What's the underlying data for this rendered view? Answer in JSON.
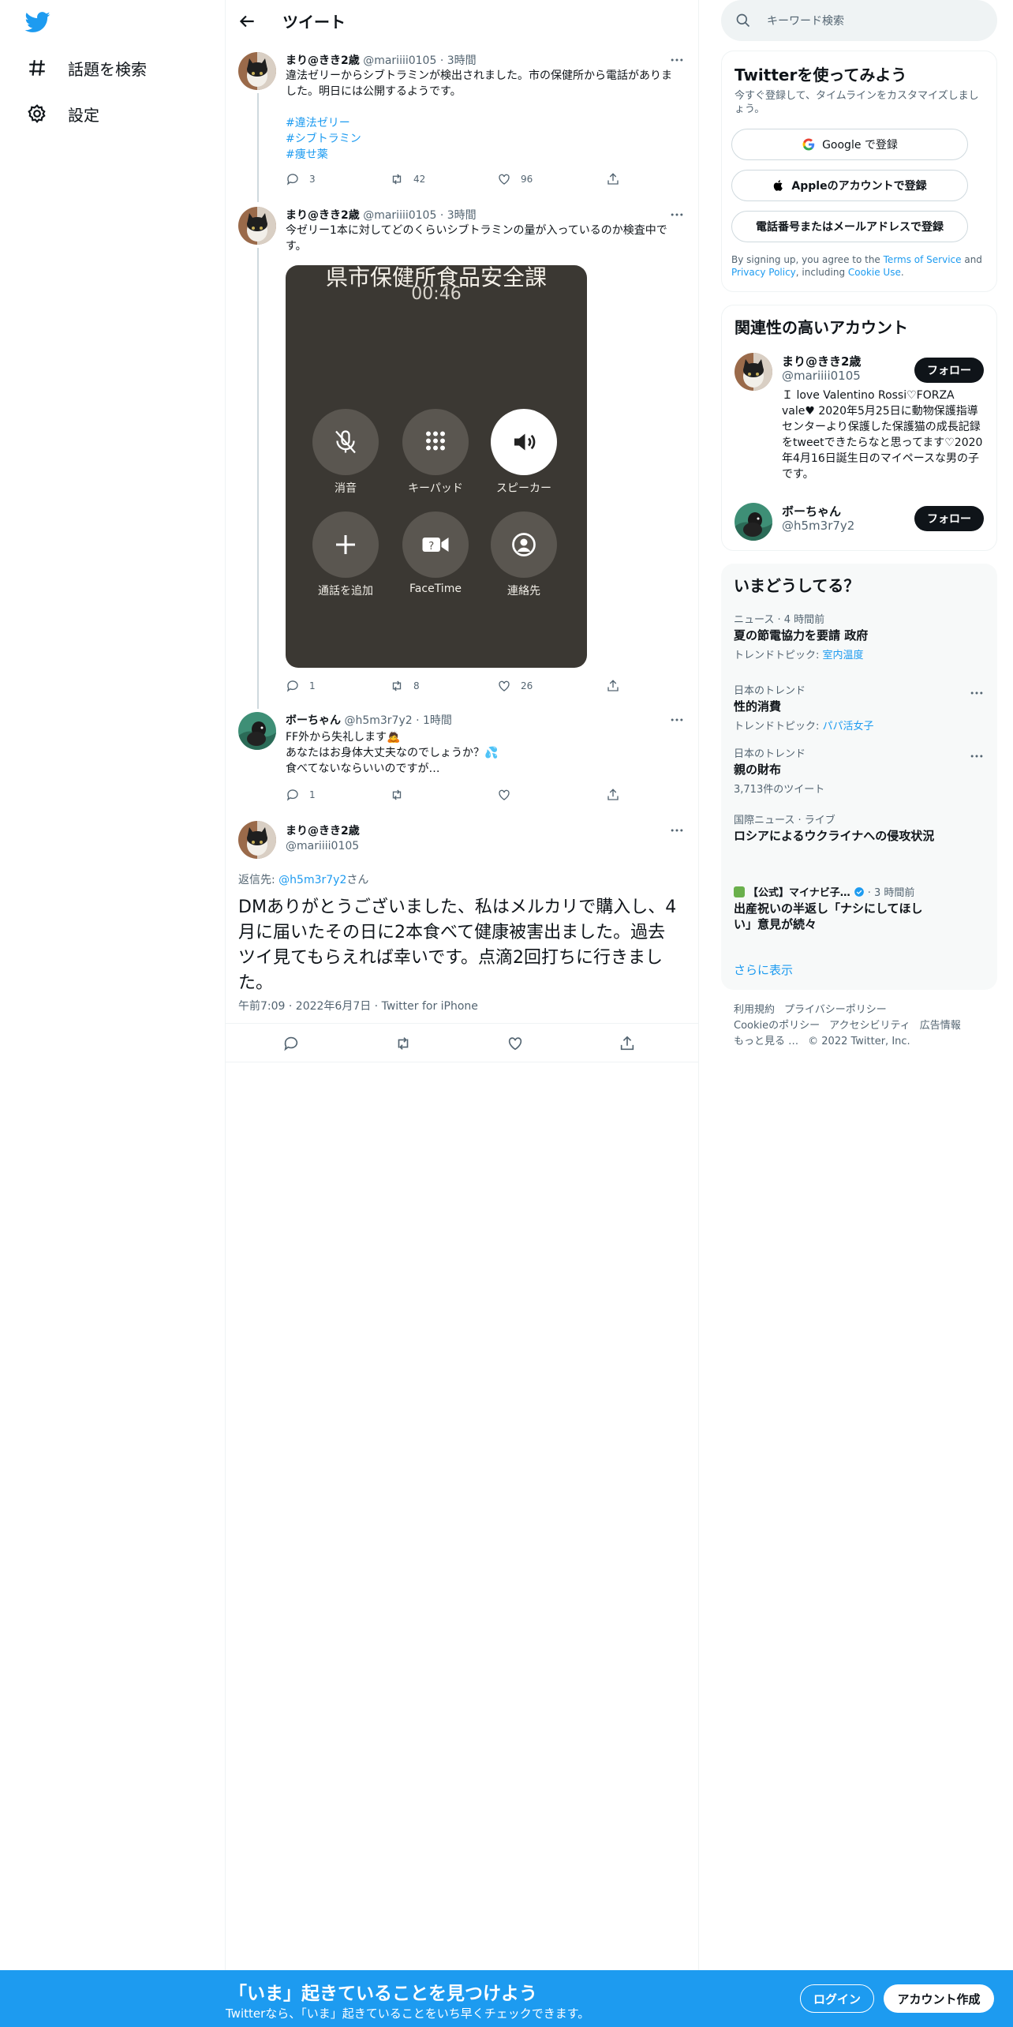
{
  "nav": {
    "items": [
      {
        "label": "話題を検索",
        "icon": "hashtag-icon"
      },
      {
        "label": "設定",
        "icon": "gear-icon"
      }
    ]
  },
  "header": {
    "title": "ツイート"
  },
  "tweets": [
    {
      "name": "まり@きき2歳",
      "handle": "@mariiii0105",
      "time": "· 3時間",
      "text": "違法ゼリーからシブトラミンが検出されました。市の保健所から電話がありました。明日には公開するようです。",
      "hashtags": [
        "#違法ゼリー",
        "#シブトラミン",
        "#痩せ薬"
      ],
      "replies": "3",
      "retweets": "42",
      "likes": "96"
    },
    {
      "name": "まり@きき2歳",
      "handle": "@mariiii0105",
      "time": "· 3時間",
      "text": "今ゼリー1本に対してどのくらいシブトラミンの量が入っているのか検査中です。",
      "replies": "1",
      "retweets": "8",
      "likes": "26",
      "call_screen": {
        "title": "県市保健所食品安全課",
        "timer": "00:46",
        "buttons": [
          "消音",
          "キーパッド",
          "スピーカー",
          "通話を追加",
          "FaceTime",
          "連絡先"
        ]
      }
    },
    {
      "name": "ボーちゃん",
      "handle": "@h5m3r7y2",
      "time": "· 1時間",
      "text_lines": [
        "FF外から失礼します🙇",
        "あなたはお身体大丈夫なのでしょうか？💦",
        "食べてないならいいのですが…"
      ],
      "replies": "1"
    }
  ],
  "focus": {
    "name": "まり@きき2歳",
    "handle": "@mariiii0105",
    "reply_prefix": "返信先: ",
    "reply_handle": "@h5m3r7y2",
    "reply_suffix": "さん",
    "text": "DMありがとうございました、私はメルカリで購入し、4月に届いたその日に2本食べて健康被害出ました。過去ツイ見てもらえれば幸いです。点滴2回打ちに行きました。",
    "meta": "午前7:09 · 2022年6月7日 · Twitter for iPhone"
  },
  "search": {
    "placeholder": "キーワード検索"
  },
  "signup_card": {
    "title": "Twitterを使ってみよう",
    "sub": "今すぐ登録して、タイムラインをカスタマイズしましょう。",
    "google": "Google で登録",
    "apple": "Appleのアカウントで登録",
    "phone": "電話番号またはメールアドレスで登録",
    "terms_pre": "By signing up, you agree to the ",
    "terms_link": "Terms of Service",
    "terms_mid": " and ",
    "privacy_link": "Privacy Policy",
    "terms_mid2": ", including ",
    "cookie_link": "Cookie Use",
    "terms_end": "."
  },
  "related": {
    "title": "関連性の高いアカウント",
    "accounts": [
      {
        "name": "まり@きき2歳",
        "handle": "@mariiii0105",
        "bio": "Ｉ love Valentino Rossi♡FORZA vale♥ 2020年5月25日に動物保護指導センターより保護した保護猫の成長記録をtweetできたらなと思ってます♡2020年4月16日誕生日のマイペースな男の子です。",
        "button": "フォロー"
      },
      {
        "name": "ボーちゃん",
        "handle": "@h5m3r7y2",
        "button": "フォロー"
      }
    ]
  },
  "trends": {
    "title": "いまどうしてる？",
    "items": [
      {
        "context": "ニュース · 4 時間前",
        "topic": "夏の節電協力を要請 政府",
        "sub_label": "トレンドトピック: ",
        "sub_link": "室内温度"
      },
      {
        "context": "日本のトレンド",
        "topic": "性的消費",
        "sub_label": "トレンドトピック: ",
        "sub_link": "パパ活女子"
      },
      {
        "context": "日本のトレンド",
        "topic": "親の財布",
        "sub_label": "3,713件のツイート",
        "sub_link": ""
      },
      {
        "context": "国際ニュース · ライブ",
        "topic": "ロシアによるウクライナへの侵攻状況",
        "sub_label": "",
        "sub_link": ""
      },
      {
        "context_source": "【公式】マイナビ子…",
        "context_time": "· 3 時間前",
        "topic": "出産祝いの半返し「ナシにしてほしい」意見が続々"
      }
    ],
    "show_more": "さらに表示"
  },
  "footer": {
    "links": [
      "利用規約",
      "プライバシーポリシー",
      "Cookieのポリシー",
      "アクセシビリティ",
      "広告情報",
      "もっと見る …",
      "© 2022 Twitter, Inc."
    ]
  },
  "banner": {
    "title": "「いま」起きていることを見つけよう",
    "sub": "Twitterなら、「いま」起きていることをいち早くチェックできます。",
    "login": "ログイン",
    "signup": "アカウント作成"
  },
  "colors": {
    "accent": "#1d9bf0",
    "text": "#0f1419",
    "secondary": "#536471"
  }
}
